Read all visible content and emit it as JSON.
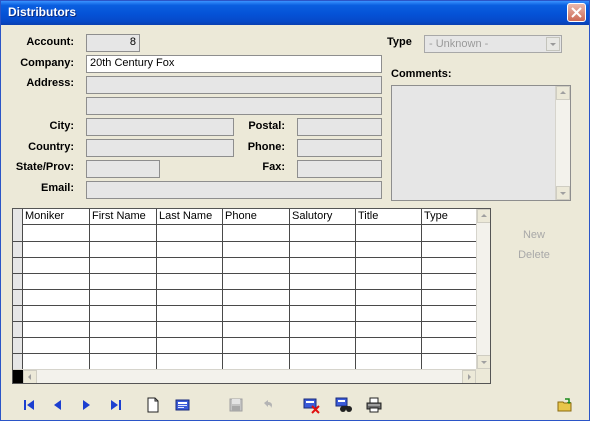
{
  "window": {
    "title": "Distributors"
  },
  "form": {
    "account": {
      "label": "Account:",
      "value": "8"
    },
    "company": {
      "label": "Company:",
      "value": "20th Century Fox"
    },
    "address": {
      "label": "Address:",
      "line1": "",
      "line2": ""
    },
    "city": {
      "label": "City:",
      "value": ""
    },
    "country": {
      "label": "Country:",
      "value": ""
    },
    "state": {
      "label": "State/Prov:",
      "value": ""
    },
    "email": {
      "label": "Email:",
      "value": ""
    },
    "postal": {
      "label": "Postal:",
      "value": ""
    },
    "phone": {
      "label": "Phone:",
      "value": ""
    },
    "fax": {
      "label": "Fax:",
      "value": ""
    },
    "type": {
      "label": "Type",
      "value": "- Unknown -"
    },
    "comments": {
      "label": "Comments:",
      "value": ""
    }
  },
  "contacts": {
    "columns": [
      "Moniker",
      "First Name",
      "Last Name",
      "Phone",
      "Salutory",
      "Title",
      "Type"
    ],
    "rows": []
  },
  "side_buttons": {
    "new_label": "New",
    "delete_label": "Delete"
  },
  "toolbar": {
    "icons": [
      "first-record-icon",
      "previous-record-icon",
      "next-record-icon",
      "last-record-icon",
      "new-record-icon",
      "edit-record-icon",
      "save-icon",
      "undo-icon",
      "delete-record-icon",
      "find-icon",
      "print-icon",
      "exit-icon"
    ]
  },
  "colors": {
    "titlebar": "#0552d6",
    "window_bg": "#ece9d8",
    "field_bg": "#e6e6e6",
    "nav_blue": "#1c3fd0"
  }
}
